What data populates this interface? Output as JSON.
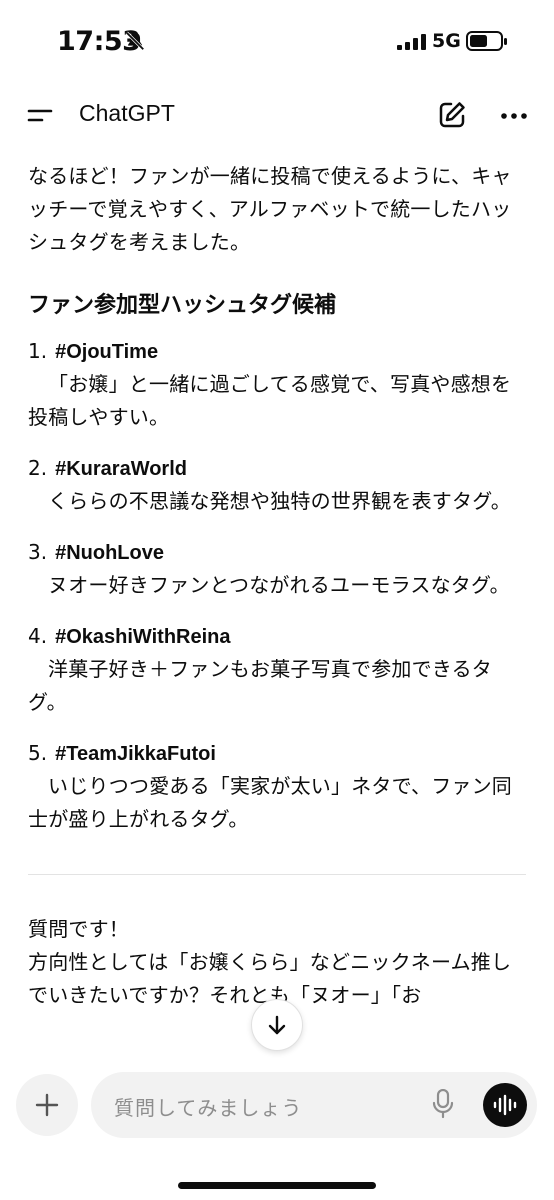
{
  "status_bar": {
    "time": "17:53",
    "network": "5G",
    "icons": [
      "bell-off-icon",
      "signal-icon",
      "battery-icon"
    ]
  },
  "header": {
    "title": "ChatGPT",
    "icons": [
      "menu-icon",
      "new-chat-icon",
      "more-icon"
    ]
  },
  "message": {
    "intro": "なるほど！ファンが一緒に投稿で使えるように、キャッチーで覚えやすく、アルファベットで統一したハッシュタグを考えました。",
    "section_heading": "ファン参加型ハッシュタグ候補",
    "tags": [
      {
        "num": "1.",
        "tag": "#OjouTime",
        "desc": "「お嬢」と一緒に過ごしてる感覚で、写真や感想を投稿しやすい。"
      },
      {
        "num": "2.",
        "tag": "#KuraraWorld",
        "desc": "くららの不思議な発想や独特の世界観を表すタグ。"
      },
      {
        "num": "3.",
        "tag": "#NuohLove",
        "desc": "ヌオー好きファンとつながれるユーモラスなタグ。"
      },
      {
        "num": "4.",
        "tag": "#OkashiWithReina",
        "desc": "洋菓子好き＋ファンもお菓子写真で参加できるタグ。"
      },
      {
        "num": "5.",
        "tag": "#TeamJikkaFutoi",
        "desc": "いじりつつ愛ある「実家が太い」ネタで、ファン同士が盛り上がれるタグ。"
      }
    ],
    "question_line1": "質問です！",
    "question_line2": "方向性としては「お嬢くらら」などニックネーム推しでいきたいですか？それとも「ヌオー」「お"
  },
  "composer": {
    "placeholder": "質問してみましょう",
    "icons": [
      "plus-icon",
      "mic-icon",
      "voice-mode-icon",
      "arrow-down-icon"
    ]
  },
  "colors": {
    "text": "#0d0d0d",
    "placeholder": "#8e8e8e",
    "pill_background": "#f2f2f2",
    "voice_button": "#0d0d0d"
  }
}
